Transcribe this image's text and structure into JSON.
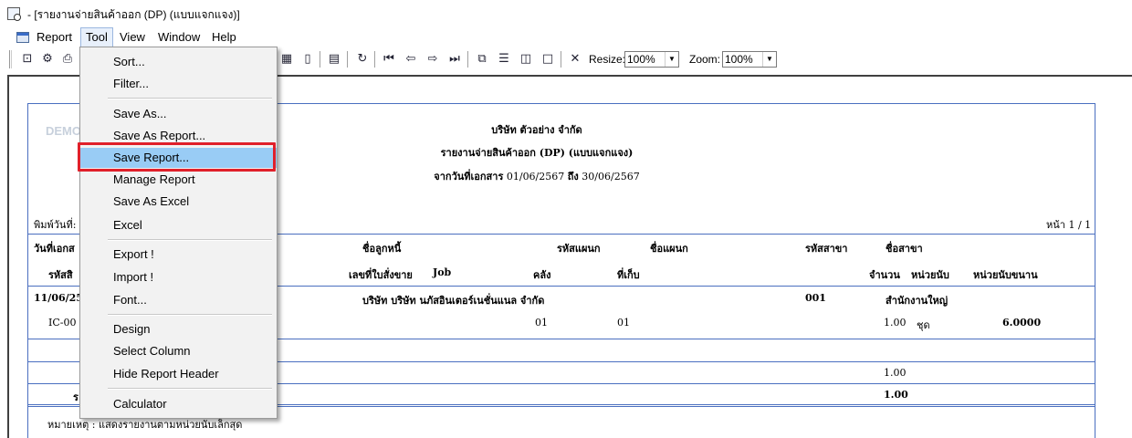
{
  "window": {
    "title": "- [รายงานจ่ายสินค้าออก (DP) (แบบแจกแจง)]"
  },
  "menubar": {
    "items": [
      "Report",
      "Tool",
      "View",
      "Window",
      "Help"
    ]
  },
  "toolbar": {
    "resize_label": "Resize:",
    "resize_value": "100%",
    "zoom_label": "Zoom:",
    "zoom_value": "100%"
  },
  "tool_menu": {
    "items": [
      "Sort...",
      "Filter...",
      "Save As...",
      "Save As Report...",
      "Save Report...",
      "Manage Report",
      "Save As Excel",
      "Excel",
      "Export !",
      "Import !",
      "Font...",
      "Design",
      "Select Column",
      "Hide Report Header",
      "Calculator"
    ],
    "highlighted": "Save Report..."
  },
  "report": {
    "watermark": "DEMO",
    "company": "บริษัท ตัวอย่าง จำกัด",
    "title": "รายงานจ่ายสินค้าออก (DP) (แบบแจกแจง)",
    "date_range_label": "จากวันที่เอกสาร",
    "date_from": "01/06/2567",
    "date_to_label": "ถึง",
    "date_to": "30/06/2567",
    "print_date_label": "พิมพ์วันที่:",
    "page_label": "หน้า",
    "page_value": "1 / 1",
    "header_row1": {
      "doc_date": "วันที่เอกส",
      "customer": "ชื่อลูกหนี้",
      "dept_code": "รหัสแผนก",
      "dept_name": "ชื่อแผนก",
      "branch_code": "รหัสสาขา",
      "branch_name": "ชื่อสาขา"
    },
    "header_row2": {
      "product_code": "รหัสสิ",
      "order_no": "เลขที่ใบสั่งขาย",
      "job": "Job",
      "warehouse": "คลัง",
      "location": "ที่เก็บ",
      "qty": "จำนวน",
      "unit": "หน่วยนับ",
      "std_unit": "หน่วยนับขนาน"
    },
    "group": {
      "date": "11/06/256",
      "customer": "บริษัท บริษัท นภัสอินเตอร์เนชั่นแนล จำกัด",
      "branch_code": "001",
      "branch_name": "สำนักงานใหญ่"
    },
    "line": {
      "product": "IC-00",
      "warehouse": "01",
      "location": "01",
      "qty": "1.00",
      "unit": "ชุด",
      "std_qty": "6.0000"
    },
    "subtotal": "1.00",
    "total_label": "ร",
    "total": "1.00",
    "note": "หมายเหตุ : แสดงรายงานตามหน่วยนับเล็กสุด"
  }
}
